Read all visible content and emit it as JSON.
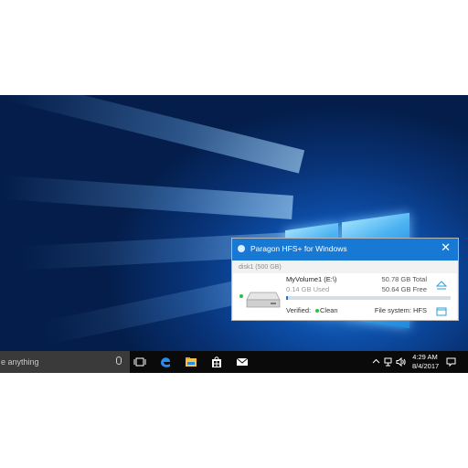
{
  "taskbar": {
    "search_placeholder": "e anything",
    "icons": [
      "task-view-icon",
      "edge-icon",
      "file-explorer-icon",
      "store-icon",
      "mail-icon"
    ],
    "tray": {
      "time": "4:29 AM",
      "date": "8/4/2017",
      "icons": [
        "chevron-up-icon",
        "network-icon",
        "volume-icon",
        "notification-icon"
      ]
    }
  },
  "popup": {
    "title": "Paragon HFS+ for Windows",
    "disk_label": "disk1 (500 GB)",
    "volume": {
      "name": "MyVolume1 (E:\\)",
      "used": "0.14 GB Used",
      "total": "50.78 GB Total",
      "free": "50.64 GB Free",
      "used_fraction": 0.003,
      "verified_label": "Verified:",
      "status": "Clean",
      "filesystem": "File system: HFS"
    }
  },
  "colors": {
    "accent": "#1879d4",
    "status_green": "#2fbf3c"
  }
}
